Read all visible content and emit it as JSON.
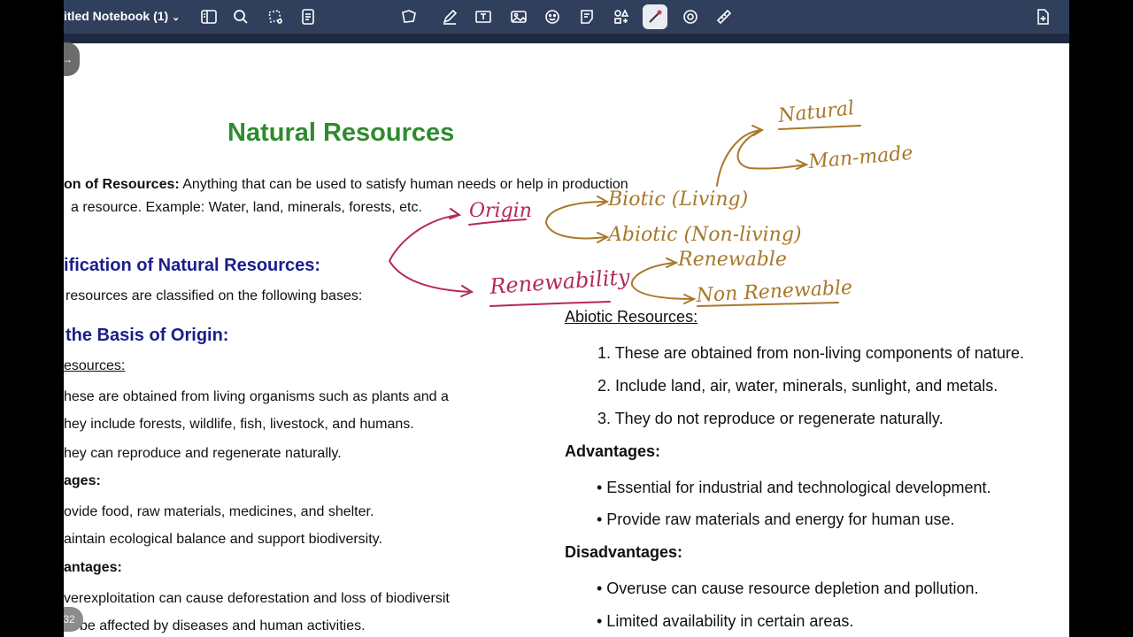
{
  "toolbar": {
    "notebook_title": "itled Notebook (1)",
    "icons": [
      "sidebar-icon",
      "search-icon",
      "lasso-icon",
      "document-icon",
      "shapes-icon",
      "pen-icon",
      "text-box-icon",
      "image-icon",
      "sticker-icon",
      "note-icon",
      "elements-icon",
      "laser-pointer-icon",
      "record-icon",
      "ruler-icon",
      "add-page-icon"
    ],
    "active_tool": "laser-pointer-icon",
    "toolbar_color": "#2f3f5c"
  },
  "page": {
    "number": "32"
  },
  "doc": {
    "title": "Natural Resources",
    "definition_label": "on of Resources:",
    "definition_text": " Anything that can be used to satisfy human needs or help in production",
    "definition_line2": "a resource. Example: Water, land, minerals, forests, etc.",
    "classification_heading": "ification of Natural Resources:",
    "classification_text": "resources are classified on the following bases:",
    "origin_heading": "the Basis of Origin:",
    "biotic_heading": "esources:",
    "biotic_points": [
      "hese are obtained from living organisms such as plants and a",
      "hey include forests, wildlife, fish, livestock, and humans.",
      "hey can reproduce and regenerate naturally."
    ],
    "biotic_adv_heading": "ages:",
    "biotic_adv": [
      "ovide food, raw materials, medicines, and shelter.",
      "aintain ecological balance and support biodiversity."
    ],
    "biotic_disadv_heading": "antages:",
    "biotic_disadv": [
      "verexploitation can cause deforestation and loss of biodiversit",
      "be affected by diseases and human activities."
    ],
    "abiotic_heading": "Abiotic Resources:",
    "abiotic_points": [
      "1. These are obtained from non-living components of nature.",
      "2. Include land, air, water, minerals, sunlight, and metals.",
      "3. They do not reproduce or regenerate naturally."
    ],
    "abiotic_adv_heading": "Advantages:",
    "abiotic_adv": [
      "• Essential for industrial and technological development.",
      "• Provide raw materials and energy for human use."
    ],
    "abiotic_disadv_heading": "Disadvantages:",
    "abiotic_disadv": [
      "• Overuse can cause resource depletion and pollution.",
      "• Limited availability in certain areas."
    ]
  },
  "handwriting": {
    "origin": "Origin",
    "renewability": "Renewability",
    "biotic": "Biotic (Living)",
    "abiotic": "Abiotic (Non-living)",
    "natural": "Natural",
    "man_made": "Man-made",
    "renewable": "Renewable",
    "non_renewable": "Non Renewable",
    "ink_pink": "#b5285a",
    "ink_gold": "#a8782a"
  }
}
